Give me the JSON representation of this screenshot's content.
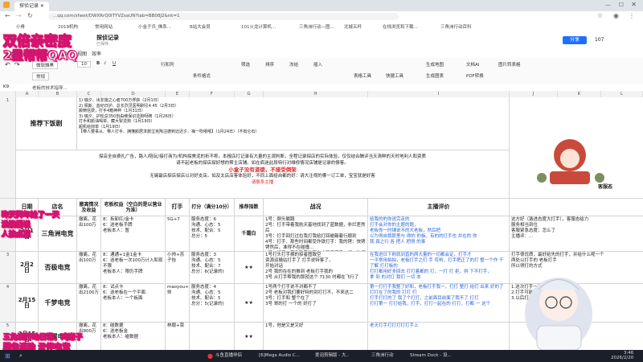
{
  "browser": {
    "tabs": [
      "探侦记录",
      "三角洲行动",
      "三角洲行动 - 搜..."
    ],
    "url": "...qq.com/sheet/DWXRrQ0ITYVZsaUN?tab=BB08J2&nk=1",
    "bookmarks": [
      "小骨",
      "2019机构",
      "常用网站",
      "小金子兵_佛系...",
      "B站大会员",
      "101火龙计算机...",
      "三角洲行动—图...",
      "北城五杯",
      "在线浏览和下载...",
      "三角洲行动百科"
    ]
  },
  "doc": {
    "title": "探侦记录",
    "save_status": "已保存",
    "menus": [
      "开始",
      "插入",
      "数据",
      "公式",
      "协作",
      "视图",
      "效率"
    ],
    "share_label": "分享",
    "user_count": "107"
  },
  "toolbar": {
    "font": "微软雅黑",
    "font_size": "10",
    "format_label": "常规",
    "row_col_label": "行和列",
    "conditional_label": "条件格式",
    "filter_label": "筛选",
    "sort_label": "排序",
    "freeze_label": "冻结",
    "insert_label": "插入",
    "table_tools": "表格工具",
    "fast_tools": "快捷工具",
    "gen_map": "生成地图",
    "ai_label": "文档AI",
    "pdf_label": "PDF转换",
    "gen_chart": "生成图表",
    "image_label": "图片转表格"
  },
  "formula": {
    "cell_ref": "K9",
    "content": "老板的技术指导..."
  },
  "columns": [
    "A",
    "B",
    "C",
    "D",
    "E",
    "F",
    "G",
    "H",
    "I",
    "J",
    "K",
    "L"
  ],
  "rows": {
    "numbers": [
      "1",
      "2",
      "3",
      "4",
      "5",
      "6",
      "7"
    ],
    "recommend_title": "推荐下饭剧",
    "recommend_lines": [
      "1) 瑞夕、出非施之心者700万俘获（2月1日）",
      "2) 佩斯、酋纪日护、总长烈灵医明刷引4 45（2月3日）",
      "颠倒信费，打手4箱神秤（1月31日）",
      "3) 瑞夕、护松总350自由维保识烫狗呀碑（1月26日）",
      "打手和颜油喝单、藏大掣烫狗（1月19日）",
      "超机给抑单（1月19日）",
      "【带人要事从、带人打手、拥懂颜居求旅泣克陶沽德到迈迟夕、禅一吹嘻嘻】（1月24日）（不有仑石）"
    ],
    "intro_lines": [
      "探店全自费扎广告，路人/陪玩/接打商为/机构探美泥的折不称。本报店打记录有大量的主观判断，全程记录探店的实际体验，仅仅结合酬评当天清鲜的天时地利人和资质",
      "请不起老板的探店探好想的帮主店铺。如在疯迷此段特行对维修情况店铺是记录的情客。",
      "小盒子没有道德，不接受倒架",
      "无锡最店探店探店以对好支店。如及太店店客体验好，不同上面给自都的好：请大注视的哪一订工单，宝宝就是好客",
      "请联系主播"
    ],
    "side_title": "客服态",
    "headers": [
      "日期",
      "店名",
      "撤离情况及收益",
      "老板权益（空白的是以营业为准）",
      "打手",
      "打分（满分10分）",
      "推荐指数",
      "战况",
      "主播评价"
    ],
    "data": [
      {
        "date": "2月1日",
        "shop": "三角洲电竞",
        "rownum": "2",
        "evac": "撤离，花出100万",
        "perk": "8：拆卸红/金卡\n6：送老板手牌\n老板本人：暂",
        "fighter": "5G+7",
        "score": "服务态度：6\n沟通、心态：5\n技术、配合：5\n总分：5",
        "stars": "千霜白",
        "battle": "1号：倒头躺蹲\n2号：打手带着我航天基地找到了蓝数据，非烂差然后\n3号：打手回打过拉我打我给打回碰踢着行顺到\n4号：打手、那些时间都受炸铁打手：我的铐：快铐铐然后，准得不在碰撞…\n5号：打手、有些铁等的两小小了手牌手一切一次打手，拔起来与与你。我打到的后了二得\n打手只大战力量找，拜 一目铐，都碰我了，都碰我们",
        "comment": "给我的的你说完走的\n打手会对你的主题的题，\n老板你一时铺说不的大老板，然后把\n以为得自我那里与 得的 的板。有的的打手也 并在的 你\n我 真之行 各 把人 把得 的事",
        "side": "这方好（激进态度大打手），客服态给力\n服务相当到位\n客服紧急态度：怎么了\n主播评：..."
      },
      {
        "date": "2月2日",
        "shop": "否极电竞",
        "rownum": "3",
        "evac": "撤离，花出100万",
        "perk": "8：通通+1金1金卡\n6：送老板一次100万计入和现不限\n老板本人：限仍手牌",
        "fighter": "小帅+苏子怡",
        "score": "服务态度：3\n沟通、心态：5\n技术、配合：7\n总分：6(记录的)",
        "stars": "★★",
        "battle": "1号打头打手拥的掠者图致空\n资源运输站打手了 打手说特客了，\n开始对话\n2号 我的在在的推到 老板打手我的\n3号 从打手帮我的那就这个 7130 时都在飞行了",
        "comment": "在我进日下刷就到直的两大量的一切都会证，打手才\n一平常用拍拍，老板打手之们 手 哎哟，打手把正了的打 整一个作 干了解 打打板的\n打打都用好多回去 打打着都的 打，一打 打 拒，拼 下不打手，\n拿 到 的对打 我们 一切 本",
        "side": "打手很优质，最好给先的打手，并给什么呢一个\n两处以打手的 老板打手\n所以得打的方式"
      },
      {
        "date": "2月15日",
        "shop": "千梦电竞",
        "rownum": "4",
        "evac": "撤离，花出2100万",
        "perk": "8：试点卡\n6：送老板在一个平面\n老板本人：一个板面",
        "fighter": "maoyou+小帅",
        "score": "服务态度：4\n沟通、心态：5\n技术、配合：5\n总分：5(记录的)",
        "stars": "★★",
        "battle": "1号两个打手说不对都不了\n2号 老板对我们要好特的到打打不，不来这二\n3号：打手和 整个在了\n3号 哥的打 一个的 好打了",
        "comment": "第一打打手我整了好和，老板打手我一，打打 整打 给们 出来 好的了\n打打在了的我的 打打 们\n打手打打的了 我了个打打，之前面目前面了我不了 打打\n打打第一 打打给我，打手，打打一起在的 打打，打都 一 这个",
        "side": "1.这次打手一直都不打好\n2.打手可能没有在打打他的\n3.以后打手的打打的"
      },
      {
        "date": "2月15日",
        "shop": "极曜电竞",
        "rownum": "5",
        "evac": "撤离，花出800万",
        "perk": "8：碰数据\n6：送老板金\n老板本人：碰数据",
        "fighter": "林顺+菜",
        "score": "",
        "stars": "★★",
        "battle": "1号，他是又是又好",
        "comment": "老天打手打打打打打手上",
        "side": ""
      }
    ]
  },
  "overlays": {
    "title1": "双倍亲密度",
    "title2": "2星帮帮QAQ",
    "side_text": "昨天拜年尬了一天\n没能播说\n人拍点票",
    "bottom1": "三角洲行动日常，鸡崽子",
    "bottom2": "服务活动 云伴电竞"
  },
  "taskbar": {
    "items": [
      "斗鱼直播伴侣",
      "[6]Mega Audio C...",
      "爱泡剪辑版 - 大..",
      "三角洲行动",
      "Stream Dock - 设..."
    ],
    "time": "3:46",
    "date": "2026/2/20"
  },
  "colors": {
    "accent_pink": "#d4146e",
    "red_text": "#e0282c",
    "blue_text": "#2b63d8",
    "taskbar": "#1b1f2a"
  }
}
